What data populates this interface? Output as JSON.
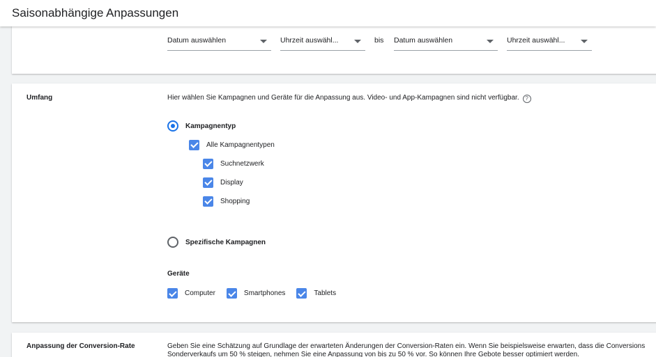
{
  "header": {
    "title": "Saisonabhängige Anpassungen"
  },
  "date_range": {
    "start_date": "Datum auswählen",
    "start_time": "Uhrzeit auswähl...",
    "separator": "bis",
    "end_date": "Datum auswählen",
    "end_time": "Uhrzeit auswähl..."
  },
  "scope": {
    "label": "Umfang",
    "description": "Hier wählen Sie Kampagnen und Geräte für die Anpassung aus. Video- und App-Kampagnen sind nicht verfügbar.",
    "help_icon": "?",
    "campaign_type": {
      "label": "Kampagnentyp",
      "selected": true,
      "all_label": "Alle Kampagnentypen",
      "types": [
        "Suchnetzwerk",
        "Display",
        "Shopping"
      ]
    },
    "specific_campaigns": {
      "label": "Spezifische Kampagnen",
      "selected": false
    },
    "devices": {
      "label": "Geräte",
      "items": [
        "Computer",
        "Smartphones",
        "Tablets"
      ]
    }
  },
  "conversion": {
    "label": "Anpassung der Conversion-Rate",
    "line1": "Geben Sie eine Schätzung auf Grundlage der erwarteten Änderungen der Conversion-Raten ein. Wenn Sie beispielsweise erwarten, dass die Conversions",
    "line2": "Sonderverkaufs um 50 % steigen, nehmen Sie eine Anpassung von bis zu 50 % vor. So können Ihre Gebote besser optimiert werden."
  },
  "colors": {
    "accent": "#1a73e8",
    "checkbox": "#4a86e8"
  }
}
